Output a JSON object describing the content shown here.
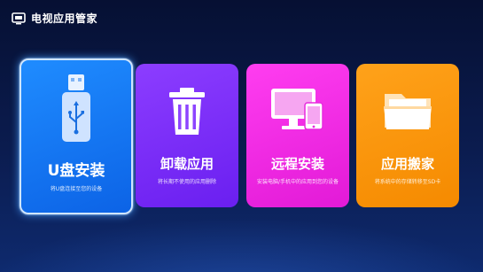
{
  "app": {
    "title": "电视应用管家",
    "icon": "tv-icon"
  },
  "cards": [
    {
      "title": "U盘安装",
      "description": "将U盘连接至您的设备",
      "icon": "usb-drive-icon",
      "color": "#1a7df5",
      "selected": true
    },
    {
      "title": "卸载应用",
      "description": "将长期不使用的应用删除",
      "icon": "trash-can-icon",
      "color": "#7a2cf7"
    },
    {
      "title": "远程安装",
      "description": "安装电脑/手机中的应用到您的设备",
      "icon": "monitor-phone-icon",
      "color": "#f02ae6"
    },
    {
      "title": "应用搬家",
      "description": "将系统中的存储转移至SD卡",
      "icon": "folder-icon",
      "color": "#fb9410"
    }
  ]
}
